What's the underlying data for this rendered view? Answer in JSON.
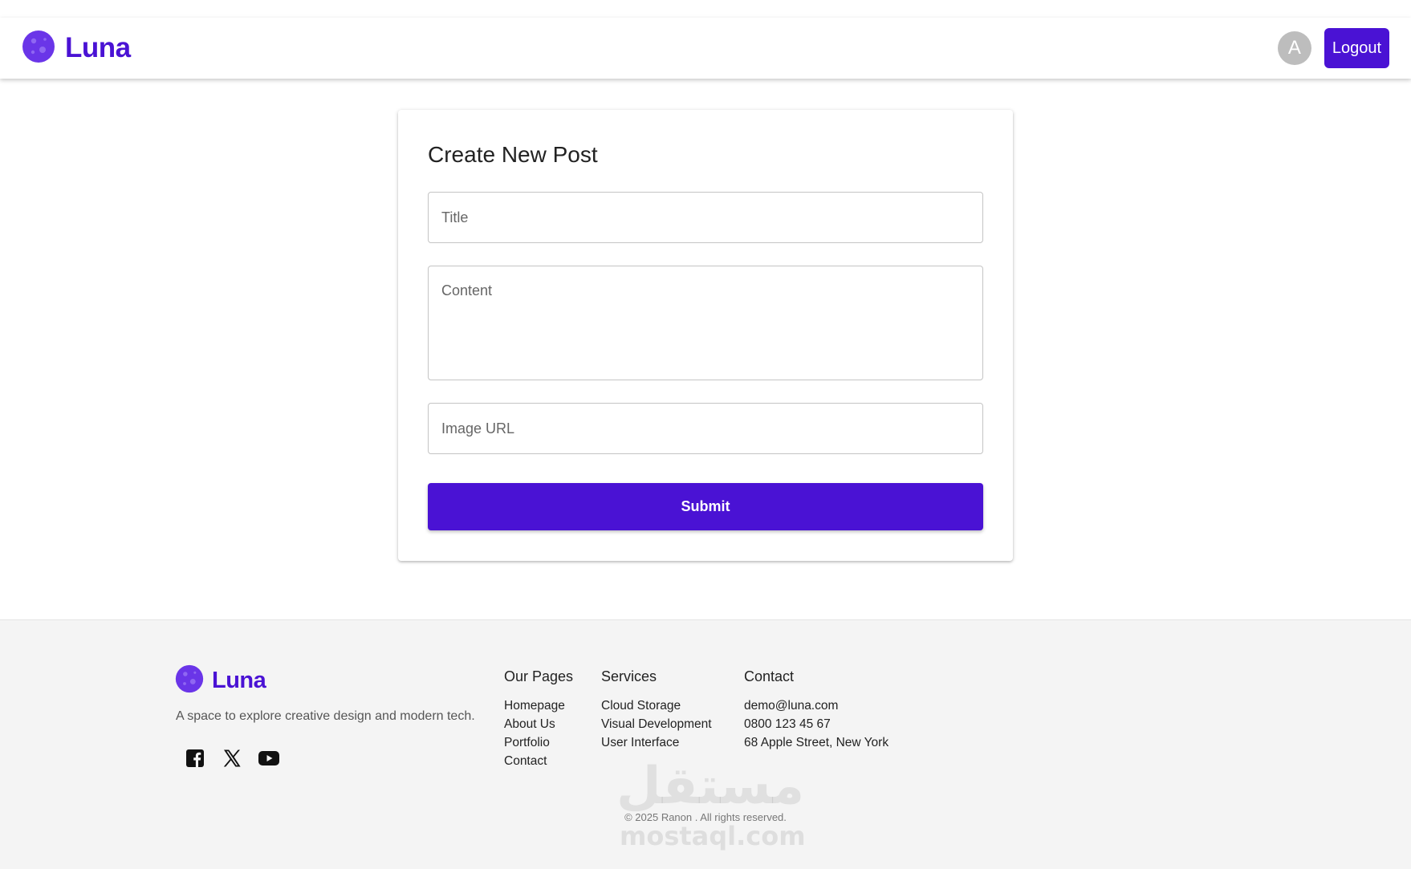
{
  "brand": {
    "name": "Luna",
    "accent_color": "#4a12d4",
    "logo_icon": "moon-logo-icon"
  },
  "header": {
    "avatar_initial": "A",
    "logout_label": "Logout"
  },
  "form": {
    "title": "Create New Post",
    "title_placeholder": "Title",
    "content_placeholder": "Content",
    "image_placeholder": "Image URL",
    "submit_label": "Submit"
  },
  "footer": {
    "tagline": "A space to explore creative design and modern tech.",
    "socials": [
      "facebook-icon",
      "x-icon",
      "youtube-icon"
    ],
    "our_pages": {
      "heading": "Our Pages",
      "items": [
        "Homepage",
        "About Us",
        "Portfolio",
        "Contact"
      ]
    },
    "services": {
      "heading": "Services",
      "items": [
        "Cloud Storage",
        "Visual Development",
        "User Interface"
      ]
    },
    "contact": {
      "heading": "Contact",
      "items": [
        "demo@luna.com",
        "0800 123 45 67",
        "68 Apple Street, New York"
      ]
    },
    "copyright": "© 2025 Ranon . All rights reserved."
  },
  "watermark": {
    "arabic": "مستقل",
    "latin": "mostaql.com"
  }
}
